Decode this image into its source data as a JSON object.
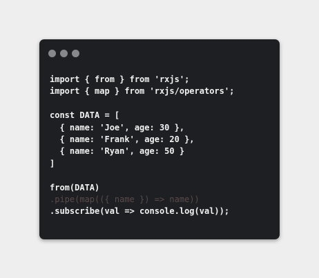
{
  "window": {
    "buttons": [
      {
        "name": "close",
        "color": "#86888c"
      },
      {
        "name": "minimize",
        "color": "#86888c"
      },
      {
        "name": "zoom",
        "color": "#86888c"
      }
    ]
  },
  "code": {
    "lines": [
      "import { from } from 'rxjs';",
      "import { map } from 'rxjs/operators';",
      "",
      "const DATA = [",
      "  { name: 'Joe', age: 30 },",
      "  { name: 'Frank', age: 20 },",
      "  { name: 'Ryan', age: 50 }",
      "]",
      "",
      "from(DATA)",
      ".pipe(map(({ name }) => name))",
      ".subscribe(val => console.log(val));"
    ]
  },
  "colors": {
    "background": "#eeeeee",
    "window": "#1e1f22",
    "text": "#f2f2f2",
    "dim_text": "#5a4a4a"
  }
}
